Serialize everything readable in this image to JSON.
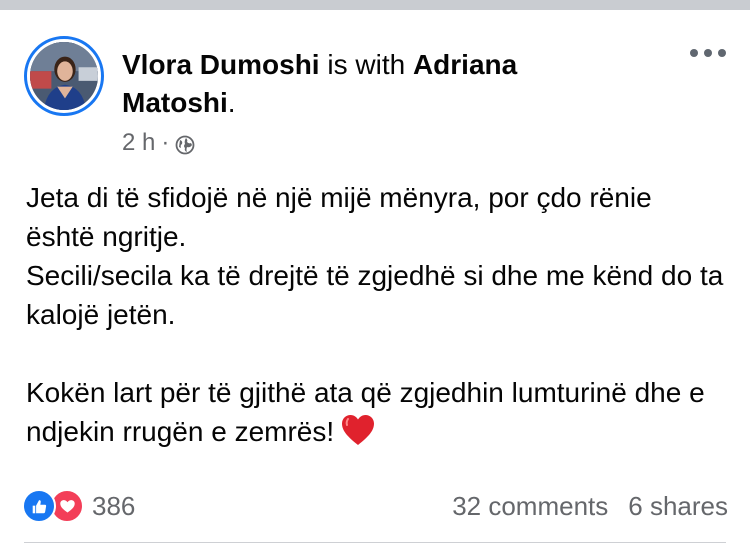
{
  "post": {
    "author": "Vlora Dumoshi",
    "with_text": " is with ",
    "tagged": "Adriana Matoshi",
    "period": ".",
    "time": "2 h",
    "dot": "·",
    "privacy_icon": "globe-icon",
    "more_icon": "more-icon",
    "body": {
      "line1": "Jeta di të sfidojë në një mijë mënyra, por çdo rënie është ngritje.",
      "line2": "Secili/secila ka të drejtë të zgjedhë si dhe me kënd do ta kalojë jetën.",
      "line3": "Kokën lart për të gjithë ata që zgjedhin lumturinë dhe e ndjekin rrugën e zemrës!",
      "emoji": "heart-emoji"
    },
    "stats": {
      "reactions": [
        "like-icon",
        "love-icon"
      ],
      "reaction_count": "386",
      "comments": "32 comments",
      "shares": "6 shares"
    }
  },
  "colors": {
    "accent": "#1877f2",
    "love": "#f33e58",
    "secondary_text": "#65676b",
    "divider": "#c9ccd1"
  }
}
